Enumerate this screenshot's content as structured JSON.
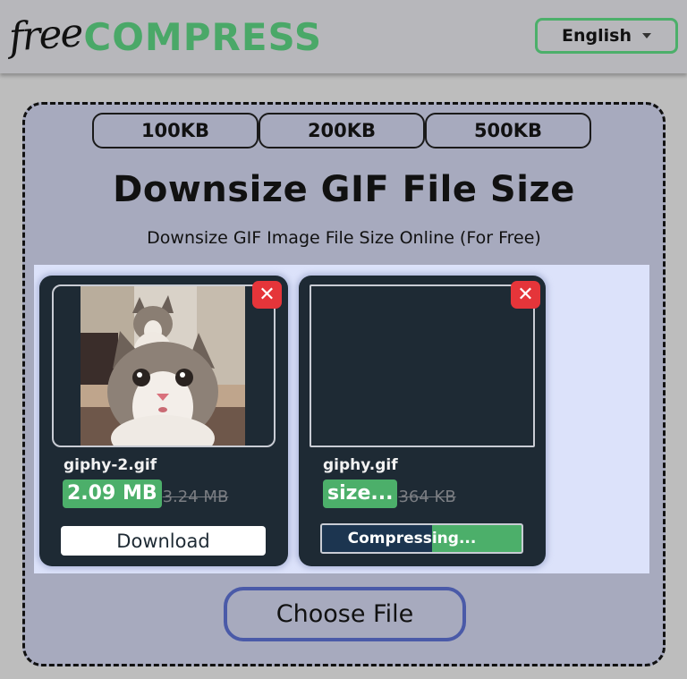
{
  "header": {
    "logo_free": "free",
    "logo_compress": "COMPRESS",
    "language_selected": "English",
    "brand_color": "#4caf6a"
  },
  "presets": [
    {
      "label": "100KB"
    },
    {
      "label": "200KB"
    },
    {
      "label": "500KB"
    }
  ],
  "main": {
    "title": "Downsize GIF File Size",
    "subtitle": "Downsize GIF Image File Size Online (For Free)",
    "choose_file_label": "Choose File"
  },
  "files": [
    {
      "name": "giphy-2.gif",
      "new_size": "2.09 MB",
      "original_size": "3.24 MB",
      "status": "done",
      "action_label": "Download",
      "remove_icon": "✕",
      "preview": "cat-image"
    },
    {
      "name": "giphy.gif",
      "new_size": "size...",
      "original_size": "364 KB",
      "status": "compressing",
      "progress_label": "Compressing...",
      "progress_percent": 55,
      "remove_icon": "✕",
      "preview": "empty"
    }
  ]
}
